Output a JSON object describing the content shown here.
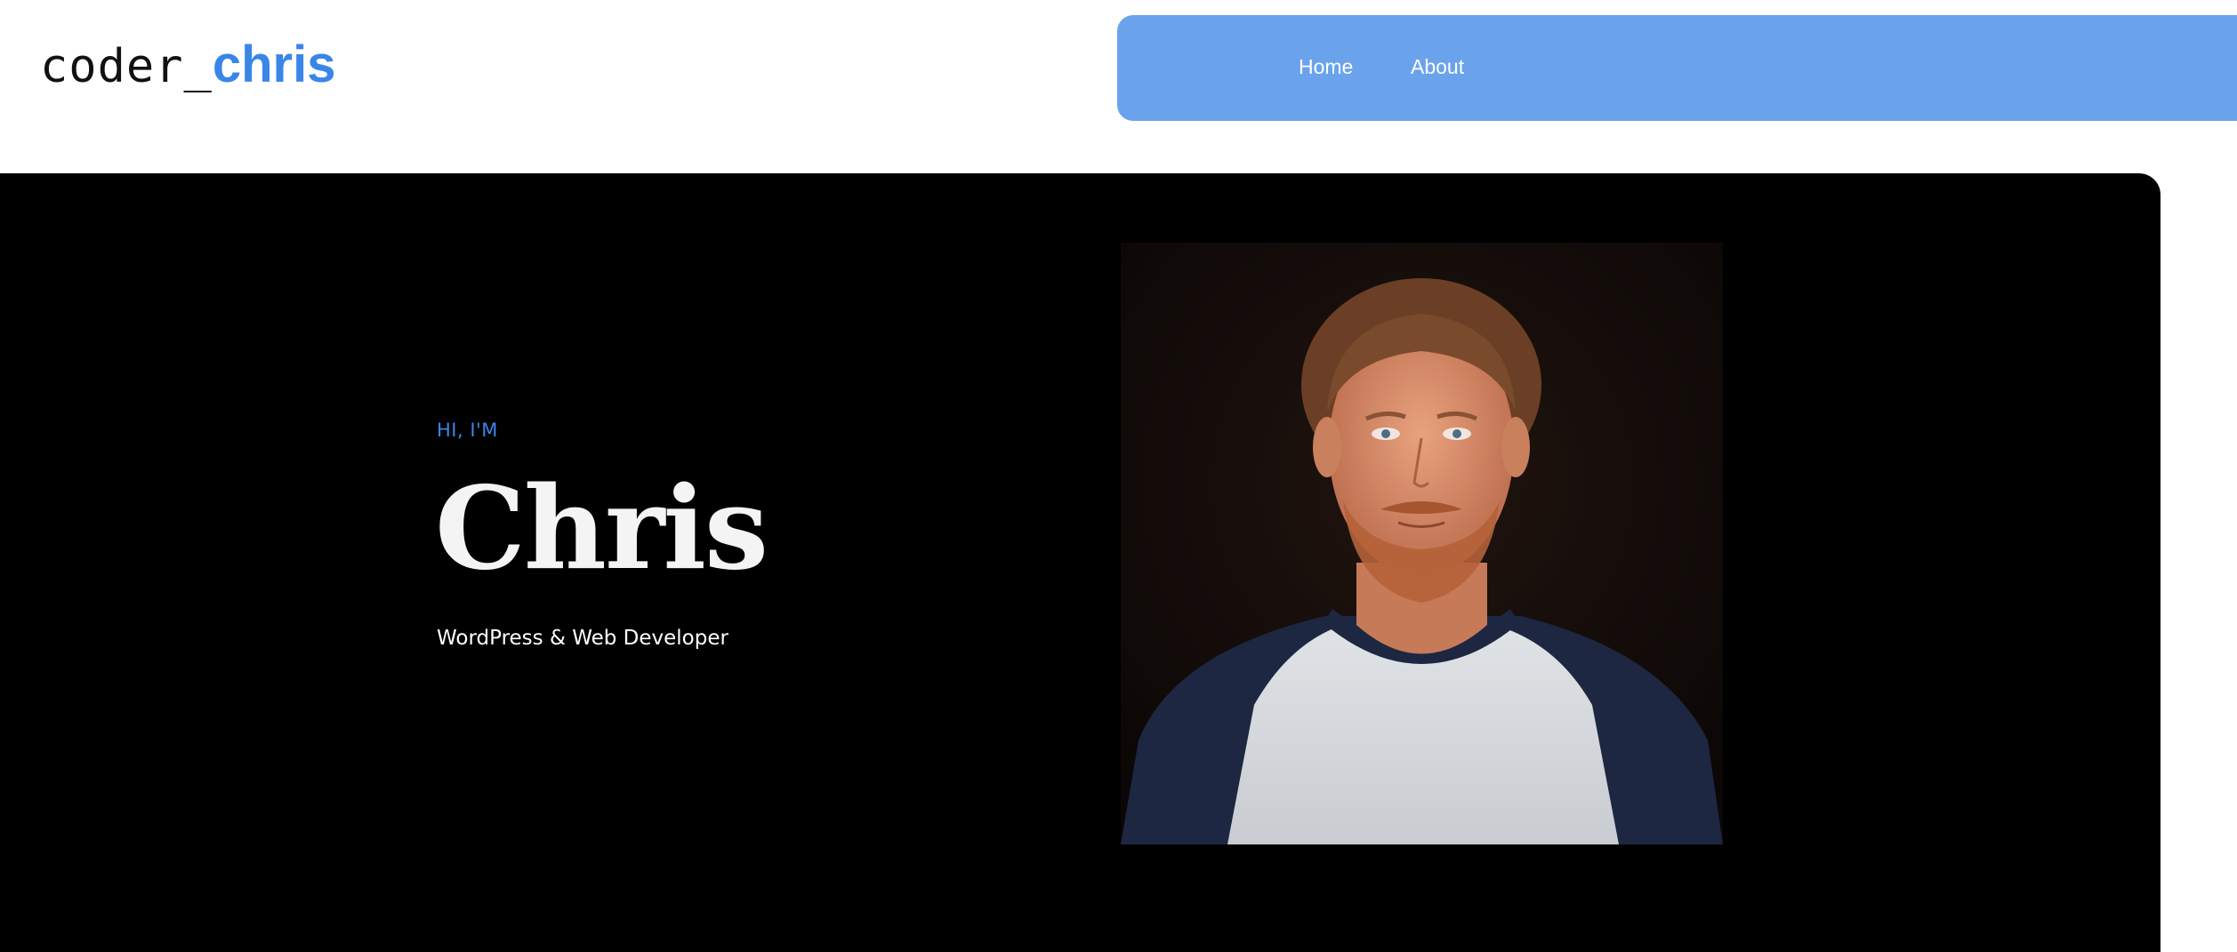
{
  "header": {
    "logo": {
      "prefix": "coder_",
      "name": "chris"
    },
    "nav": {
      "home_label": "Home",
      "about_label": "About"
    }
  },
  "hero": {
    "eyebrow": "HI, I'M",
    "name": "Chris",
    "role": "WordPress & Web Developer"
  },
  "colors": {
    "accent": "#3a86e8",
    "nav_background": "#6aa3ec",
    "hero_background": "#000000",
    "hero_text": "#f4f4f4"
  }
}
